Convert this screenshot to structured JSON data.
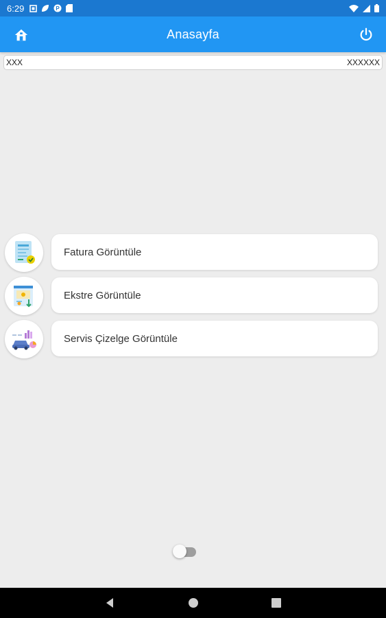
{
  "status_bar": {
    "time": "6:29",
    "icons": [
      "notification-icon",
      "leaf-icon",
      "app-icon",
      "sd-card-icon"
    ],
    "right_icons": [
      "wifi-icon",
      "signal-icon",
      "battery-icon"
    ]
  },
  "app_bar": {
    "title": "Anasayfa",
    "left_icon": "home-icon",
    "right_icon": "power-icon",
    "color": "#2196f3"
  },
  "user_bar": {
    "left_text": "XXX",
    "right_text": "XXXXXX"
  },
  "menu": {
    "items": [
      {
        "label": "Fatura Görüntüle",
        "icon": "invoice-icon"
      },
      {
        "label": "Ekstre Görüntüle",
        "icon": "statement-icon"
      },
      {
        "label": "Servis Çizelge Görüntüle",
        "icon": "service-chart-icon"
      }
    ]
  },
  "theme_toggle": {
    "state": "off",
    "icon": "moon-icon"
  },
  "nav_bar": {
    "buttons": [
      "back-icon",
      "home-circle-icon",
      "recents-icon"
    ]
  }
}
